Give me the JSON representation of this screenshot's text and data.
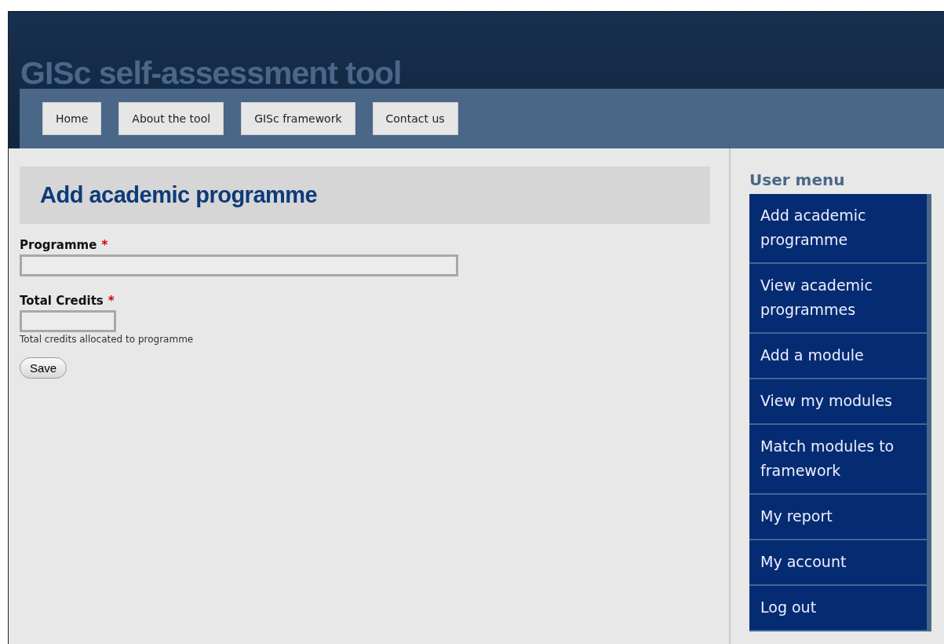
{
  "site_title": "GISc self-assessment tool",
  "nav": [
    "Home",
    "About the tool",
    "GISc framework",
    "Contact us"
  ],
  "page_title": "Add academic programme",
  "fields": [
    {
      "label": "Programme",
      "required_mark": "*",
      "kind": "wide"
    },
    {
      "label": "Total Credits",
      "required_mark": "*",
      "kind": "short",
      "description": "Total credits allocated to programme"
    }
  ],
  "save_button": "Save",
  "user_menu": {
    "title": "User menu",
    "items": [
      "Add academic programme",
      "View academic programmes",
      "Add a module",
      "View my modules",
      "Match modules to framework",
      "My report",
      "My account",
      "Log out"
    ]
  }
}
